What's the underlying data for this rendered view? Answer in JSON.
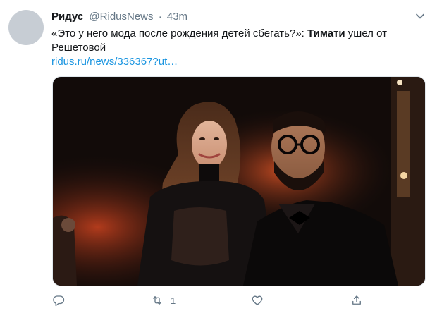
{
  "author": {
    "name": "Ридус",
    "handle": "@RidusNews",
    "separator": "·",
    "time": "43m"
  },
  "tweet": {
    "text_part1": "«Это у него мода после рождения детей сбегать?»: ",
    "text_bold": "Тимати",
    "text_part2": " ушел от Решетовой",
    "link": "ridus.ru/news/336367?ut…"
  },
  "media": {
    "description_icon": "photo"
  },
  "actions": {
    "reply_icon": "reply-icon",
    "retweet_icon": "retweet-icon",
    "retweet_count": "1",
    "like_icon": "heart-icon",
    "share_icon": "share-icon"
  },
  "colors": {
    "link": "#1b95e0",
    "secondary": "#657786",
    "primary_text": "#14171a"
  }
}
